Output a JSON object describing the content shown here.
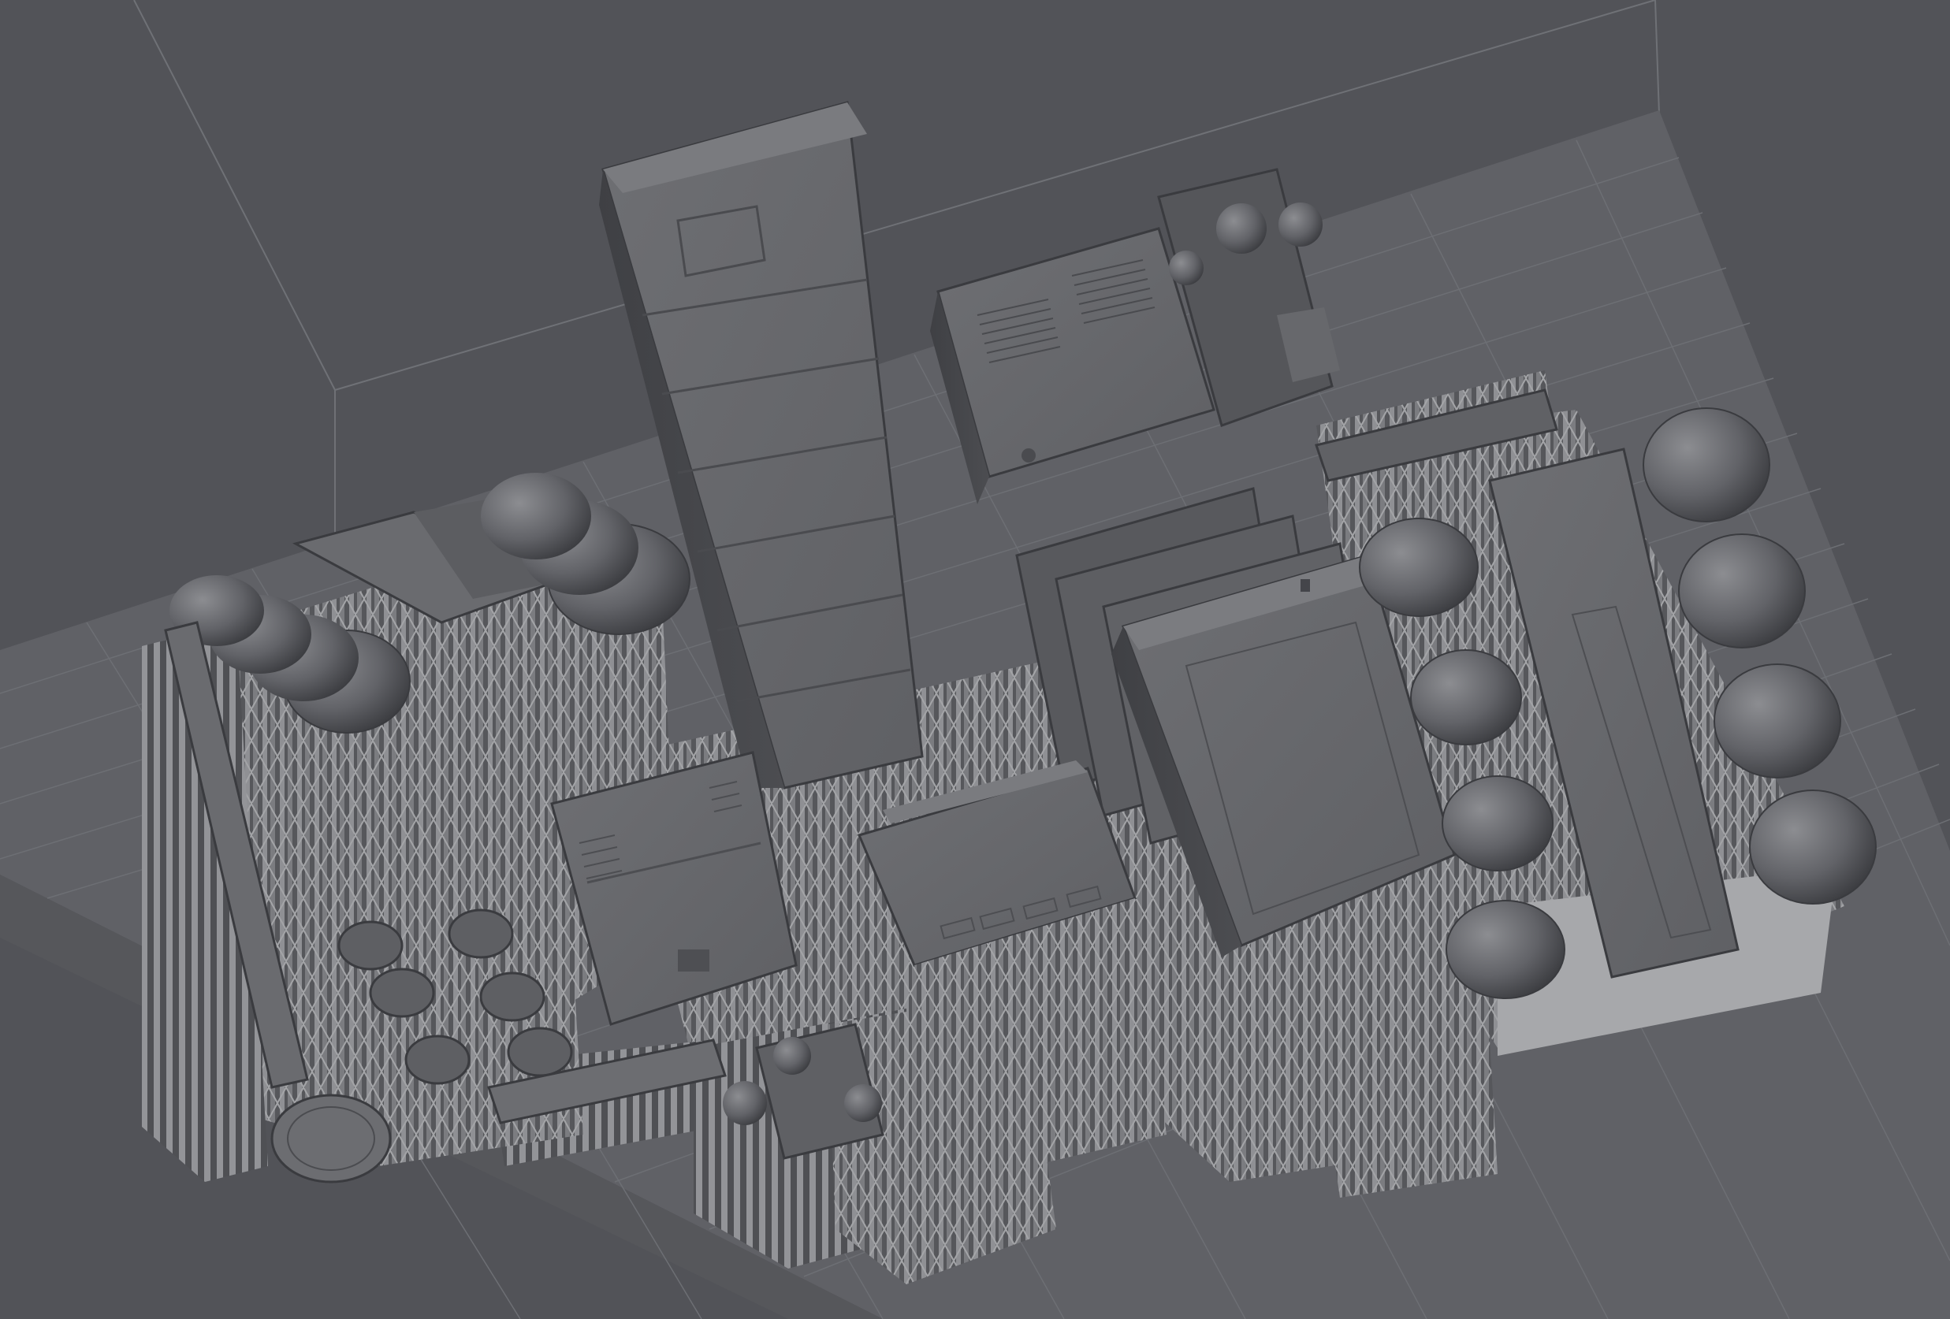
{
  "viewport": {
    "name": "slicer-3d-viewport",
    "background_color": "#525358",
    "build_plate_color": "#606166",
    "grid_color": "#73757b",
    "model_color": "#6d6e72",
    "support_color": "#9a9b9e"
  }
}
